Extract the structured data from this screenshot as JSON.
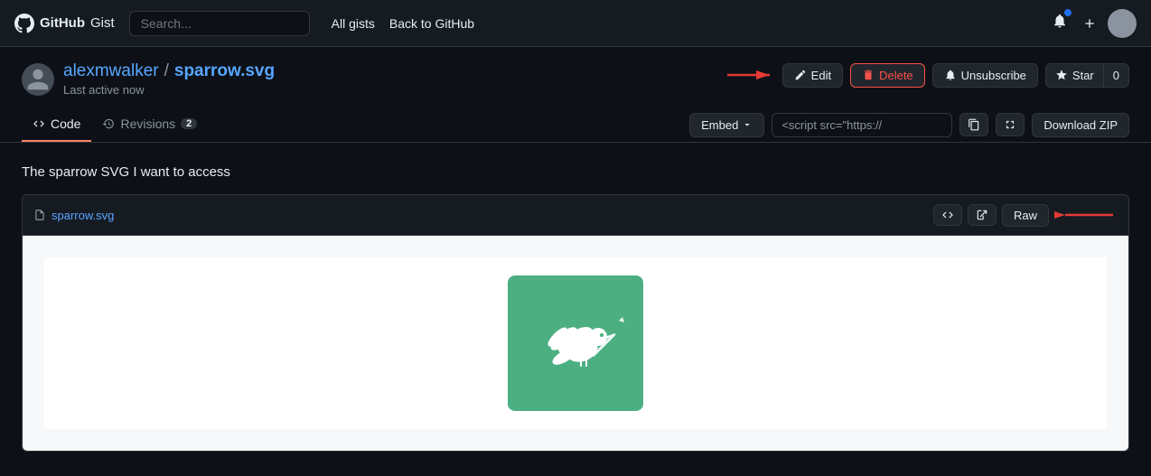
{
  "header": {
    "logo_github": "GitHub",
    "logo_gist": "Gist",
    "search_placeholder": "Search...",
    "nav": [
      {
        "label": "All gists",
        "href": "#"
      },
      {
        "label": "Back to GitHub",
        "href": "#"
      }
    ]
  },
  "gist": {
    "username": "alexmwalker",
    "filename": "sparrow.svg",
    "last_active": "Last active now",
    "description": "The sparrow SVG I want to access"
  },
  "gist_actions": {
    "edit_label": "Edit",
    "delete_label": "Delete",
    "unsubscribe_label": "Unsubscribe",
    "star_label": "Star",
    "star_count": "0"
  },
  "tabs": {
    "code_label": "Code",
    "revisions_label": "Revisions",
    "revisions_count": "2"
  },
  "toolbar": {
    "embed_label": "Embed",
    "embed_value": "<script src=\"https://",
    "download_label": "Download ZIP"
  },
  "file": {
    "name": "sparrow.svg",
    "raw_label": "Raw"
  },
  "colors": {
    "accent": "#58a6ff",
    "background": "#0d1117",
    "header_bg": "#161b22",
    "border": "#30363d",
    "file_bg": "#f6f8fa",
    "sparrow_green": "#4CAF82",
    "delete_red": "#f85149",
    "tab_active_border": "#f78166"
  }
}
